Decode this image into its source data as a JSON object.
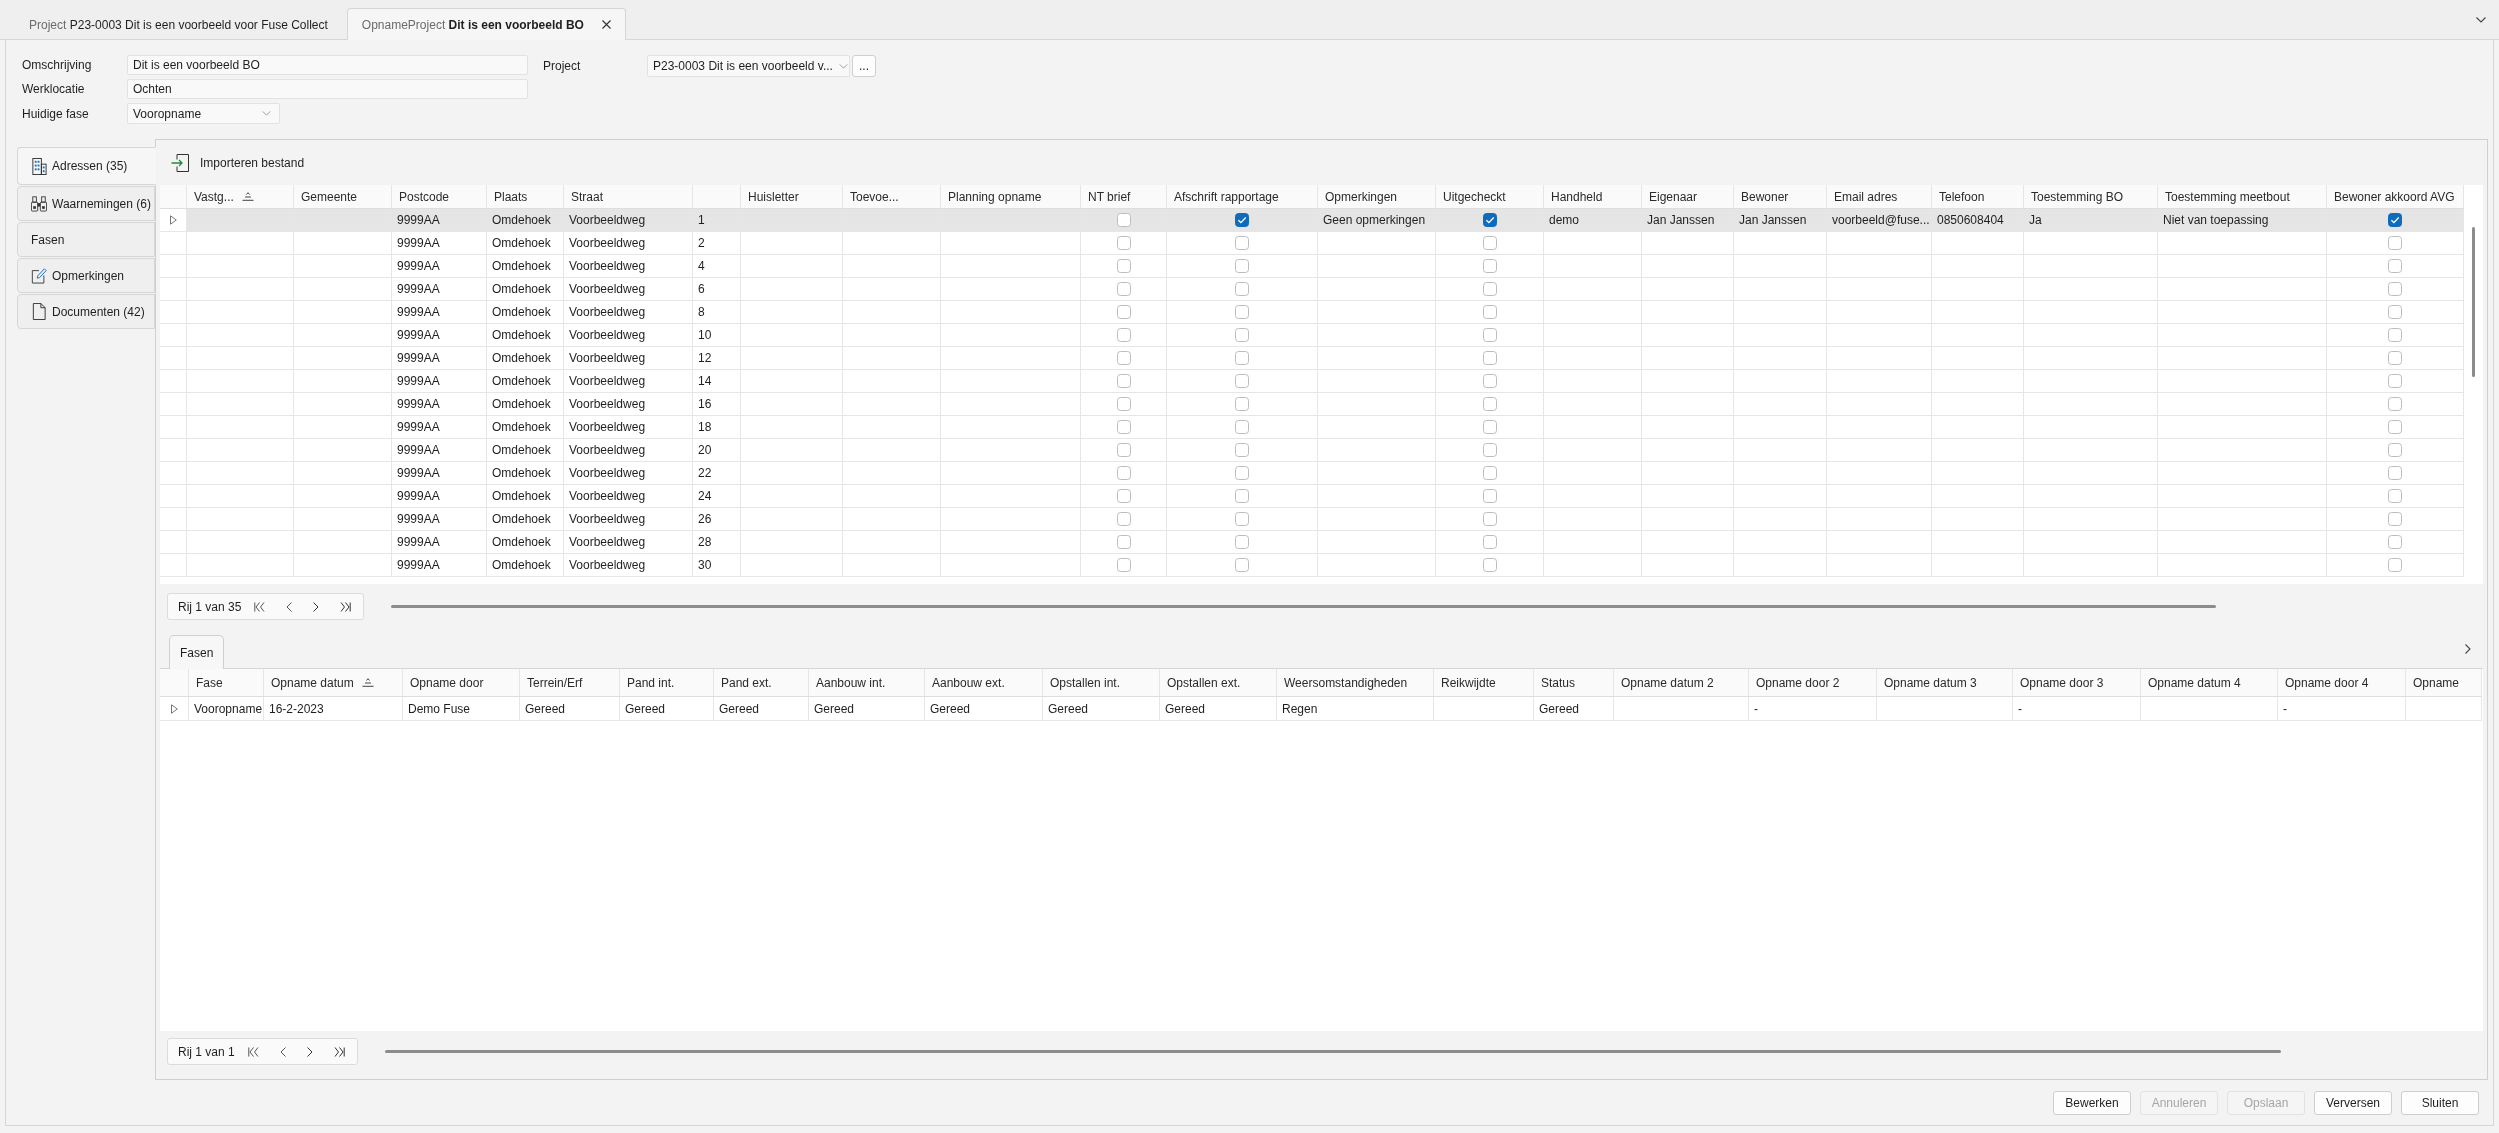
{
  "document_tabs": [
    {
      "prefix": "Project",
      "title": "P23-0003 Dit is een voorbeeld voor Fuse Collect",
      "selected": false
    },
    {
      "prefix": "OpnameProject",
      "title": "Dit is een voorbeeld BO",
      "selected": true
    }
  ],
  "form": {
    "fields": [
      {
        "label": "Omschrijving",
        "value": "Dit is een voorbeeld BO",
        "kind": "text"
      },
      {
        "label": "Werklocatie",
        "value": "Ochten",
        "kind": "text"
      },
      {
        "label": "Huidige fase",
        "value": "Vooropname",
        "kind": "dropdown"
      }
    ],
    "project": {
      "label": "Project",
      "value": "P23-0003 Dit is een voorbeeld v...",
      "kind": "dropdown",
      "browse_button": "..."
    }
  },
  "side_tabs": [
    {
      "label": "Adressen (35)",
      "selected": true
    },
    {
      "label": "Waarnemingen (6)",
      "selected": false
    },
    {
      "label": "Fasen",
      "selected": false
    },
    {
      "label": "Opmerkingen",
      "selected": false
    },
    {
      "label": "Documenten (42)",
      "selected": false
    }
  ],
  "addresses": {
    "toolbar": {
      "import_button": "Importeren bestand"
    },
    "table": {
      "columns": [
        {
          "label": "Vastg...",
          "sorted": true
        },
        {
          "label": "Gemeente",
          "sorted": false
        },
        {
          "label": "Postcode",
          "sorted": false
        },
        {
          "label": "Plaats",
          "sorted": false
        },
        {
          "label": "Straat",
          "sorted": false
        },
        {
          "sorted": false
        },
        {
          "label": "Huisletter",
          "sorted": false
        },
        {
          "label": "Toevoe...",
          "sorted": false
        },
        {
          "label": "Planning opname",
          "sorted": false
        },
        {
          "label": "NT brief",
          "sorted": false
        },
        {
          "label": "Afschrift rapportage",
          "sorted": false
        },
        {
          "label": "Opmerkingen",
          "sorted": false
        },
        {
          "label": "Uitgecheckt",
          "sorted": false
        },
        {
          "label": "Handheld",
          "sorted": false
        },
        {
          "label": "Eigenaar",
          "sorted": false
        },
        {
          "label": "Bewoner",
          "sorted": false
        },
        {
          "label": "Email adres",
          "sorted": false
        },
        {
          "label": "Telefoon",
          "sorted": false
        },
        {
          "label": "Toestemming BO",
          "sorted": false
        },
        {
          "label": "Toestemming meetbout",
          "sorted": false
        },
        {
          "label": "Bewoner akkoord AVG",
          "sorted": false
        }
      ],
      "rows": [
        {
          "current": true,
          "selected": true,
          "cells": [
            null,
            null,
            "9999AA",
            "Omdehoek",
            "Voorbeeldweg",
            "1",
            null,
            null,
            null,
            {
              "checked": false
            },
            {
              "checked": true
            },
            "Geen opmerkingen",
            {
              "checked": true
            },
            "demo",
            "Jan Janssen",
            "Jan Janssen",
            "voorbeeld@fuse...",
            "0850608404",
            "Ja",
            "Niet van toepassing",
            {
              "checked": true
            }
          ]
        },
        {
          "current": false,
          "selected": false,
          "cells": [
            null,
            null,
            "9999AA",
            "Omdehoek",
            "Voorbeeldweg",
            "2",
            null,
            null,
            null,
            {
              "checked": false
            },
            {
              "checked": false
            },
            null,
            {
              "checked": false
            },
            null,
            null,
            null,
            null,
            null,
            null,
            null,
            {
              "checked": false
            }
          ]
        },
        {
          "current": false,
          "selected": false,
          "cells": [
            null,
            null,
            "9999AA",
            "Omdehoek",
            "Voorbeeldweg",
            "4",
            null,
            null,
            null,
            {
              "checked": false
            },
            {
              "checked": false
            },
            null,
            {
              "checked": false
            },
            null,
            null,
            null,
            null,
            null,
            null,
            null,
            {
              "checked": false
            }
          ]
        },
        {
          "current": false,
          "selected": false,
          "cells": [
            null,
            null,
            "9999AA",
            "Omdehoek",
            "Voorbeeldweg",
            "6",
            null,
            null,
            null,
            {
              "checked": false
            },
            {
              "checked": false
            },
            null,
            {
              "checked": false
            },
            null,
            null,
            null,
            null,
            null,
            null,
            null,
            {
              "checked": false
            }
          ]
        },
        {
          "current": false,
          "selected": false,
          "cells": [
            null,
            null,
            "9999AA",
            "Omdehoek",
            "Voorbeeldweg",
            "8",
            null,
            null,
            null,
            {
              "checked": false
            },
            {
              "checked": false
            },
            null,
            {
              "checked": false
            },
            null,
            null,
            null,
            null,
            null,
            null,
            null,
            {
              "checked": false
            }
          ]
        },
        {
          "current": false,
          "selected": false,
          "cells": [
            null,
            null,
            "9999AA",
            "Omdehoek",
            "Voorbeeldweg",
            "10",
            null,
            null,
            null,
            {
              "checked": false
            },
            {
              "checked": false
            },
            null,
            {
              "checked": false
            },
            null,
            null,
            null,
            null,
            null,
            null,
            null,
            {
              "checked": false
            }
          ]
        },
        {
          "current": false,
          "selected": false,
          "cells": [
            null,
            null,
            "9999AA",
            "Omdehoek",
            "Voorbeeldweg",
            "12",
            null,
            null,
            null,
            {
              "checked": false
            },
            {
              "checked": false
            },
            null,
            {
              "checked": false
            },
            null,
            null,
            null,
            null,
            null,
            null,
            null,
            {
              "checked": false
            }
          ]
        },
        {
          "current": false,
          "selected": false,
          "cells": [
            null,
            null,
            "9999AA",
            "Omdehoek",
            "Voorbeeldweg",
            "14",
            null,
            null,
            null,
            {
              "checked": false
            },
            {
              "checked": false
            },
            null,
            {
              "checked": false
            },
            null,
            null,
            null,
            null,
            null,
            null,
            null,
            {
              "checked": false
            }
          ]
        },
        {
          "current": false,
          "selected": false,
          "cells": [
            null,
            null,
            "9999AA",
            "Omdehoek",
            "Voorbeeldweg",
            "16",
            null,
            null,
            null,
            {
              "checked": false
            },
            {
              "checked": false
            },
            null,
            {
              "checked": false
            },
            null,
            null,
            null,
            null,
            null,
            null,
            null,
            {
              "checked": false
            }
          ]
        },
        {
          "current": false,
          "selected": false,
          "cells": [
            null,
            null,
            "9999AA",
            "Omdehoek",
            "Voorbeeldweg",
            "18",
            null,
            null,
            null,
            {
              "checked": false
            },
            {
              "checked": false
            },
            null,
            {
              "checked": false
            },
            null,
            null,
            null,
            null,
            null,
            null,
            null,
            {
              "checked": false
            }
          ]
        },
        {
          "current": false,
          "selected": false,
          "cells": [
            null,
            null,
            "9999AA",
            "Omdehoek",
            "Voorbeeldweg",
            "20",
            null,
            null,
            null,
            {
              "checked": false
            },
            {
              "checked": false
            },
            null,
            {
              "checked": false
            },
            null,
            null,
            null,
            null,
            null,
            null,
            null,
            {
              "checked": false
            }
          ]
        },
        {
          "current": false,
          "selected": false,
          "cells": [
            null,
            null,
            "9999AA",
            "Omdehoek",
            "Voorbeeldweg",
            "22",
            null,
            null,
            null,
            {
              "checked": false
            },
            {
              "checked": false
            },
            null,
            {
              "checked": false
            },
            null,
            null,
            null,
            null,
            null,
            null,
            null,
            {
              "checked": false
            }
          ]
        },
        {
          "current": false,
          "selected": false,
          "cells": [
            null,
            null,
            "9999AA",
            "Omdehoek",
            "Voorbeeldweg",
            "24",
            null,
            null,
            null,
            {
              "checked": false
            },
            {
              "checked": false
            },
            null,
            {
              "checked": false
            },
            null,
            null,
            null,
            null,
            null,
            null,
            null,
            {
              "checked": false
            }
          ]
        },
        {
          "current": false,
          "selected": false,
          "cells": [
            null,
            null,
            "9999AA",
            "Omdehoek",
            "Voorbeeldweg",
            "26",
            null,
            null,
            null,
            {
              "checked": false
            },
            {
              "checked": false
            },
            null,
            {
              "checked": false
            },
            null,
            null,
            null,
            null,
            null,
            null,
            null,
            {
              "checked": false
            }
          ]
        },
        {
          "current": false,
          "selected": false,
          "cells": [
            null,
            null,
            "9999AA",
            "Omdehoek",
            "Voorbeeldweg",
            "28",
            null,
            null,
            null,
            {
              "checked": false
            },
            {
              "checked": false
            },
            null,
            {
              "checked": false
            },
            null,
            null,
            null,
            null,
            null,
            null,
            null,
            {
              "checked": false
            }
          ]
        },
        {
          "current": false,
          "selected": false,
          "cells": [
            null,
            null,
            "9999AA",
            "Omdehoek",
            "Voorbeeldweg",
            "30",
            null,
            null,
            null,
            {
              "checked": false
            },
            {
              "checked": false
            },
            null,
            {
              "checked": false
            },
            null,
            null,
            null,
            null,
            null,
            null,
            null,
            {
              "checked": false
            }
          ]
        }
      ]
    },
    "pager": {
      "label": "Rij 1 van 35"
    }
  },
  "phases": {
    "tabs": [
      {
        "label": "Fasen",
        "selected": true
      }
    ],
    "table": {
      "columns": [
        {
          "label": "Fase",
          "sorted": false
        },
        {
          "label": "Opname datum",
          "sorted": true
        },
        {
          "label": "Opname door",
          "sorted": false
        },
        {
          "label": "Terrein/Erf",
          "sorted": false
        },
        {
          "label": "Pand int.",
          "sorted": false
        },
        {
          "label": "Pand ext.",
          "sorted": false
        },
        {
          "label": "Aanbouw int.",
          "sorted": false
        },
        {
          "label": "Aanbouw ext.",
          "sorted": false
        },
        {
          "label": "Opstallen int.",
          "sorted": false
        },
        {
          "label": "Opstallen ext.",
          "sorted": false
        },
        {
          "label": "Weersomstandigheden",
          "sorted": false
        },
        {
          "label": "Reikwijdte",
          "sorted": false
        },
        {
          "label": "Status",
          "sorted": false
        },
        {
          "label": "Opname datum 2",
          "sorted": false
        },
        {
          "label": "Opname door 2",
          "sorted": false
        },
        {
          "label": "Opname datum 3",
          "sorted": false
        },
        {
          "label": "Opname door 3",
          "sorted": false
        },
        {
          "label": "Opname datum 4",
          "sorted": false
        },
        {
          "label": "Opname door 4",
          "sorted": false
        },
        {
          "label": "Opname",
          "sorted": false
        }
      ],
      "rows": [
        {
          "current": true,
          "selected": false,
          "cells": [
            "Vooropname",
            "16-2-2023",
            "Demo Fuse",
            "Gereed",
            "Gereed",
            "Gereed",
            "Gereed",
            "Gereed",
            "Gereed",
            "Gereed",
            "Regen",
            null,
            "Gereed",
            null,
            "-",
            null,
            "-",
            null,
            "-",
            null
          ]
        }
      ]
    },
    "pager": {
      "label": "Rij 1 van 1"
    }
  },
  "buttons": [
    {
      "label": "Bewerken",
      "disabled": false
    },
    {
      "label": "Annuleren",
      "disabled": true
    },
    {
      "label": "Opslaan",
      "disabled": true
    },
    {
      "label": "Verversen",
      "disabled": false
    },
    {
      "label": "Sluiten",
      "disabled": false
    }
  ]
}
